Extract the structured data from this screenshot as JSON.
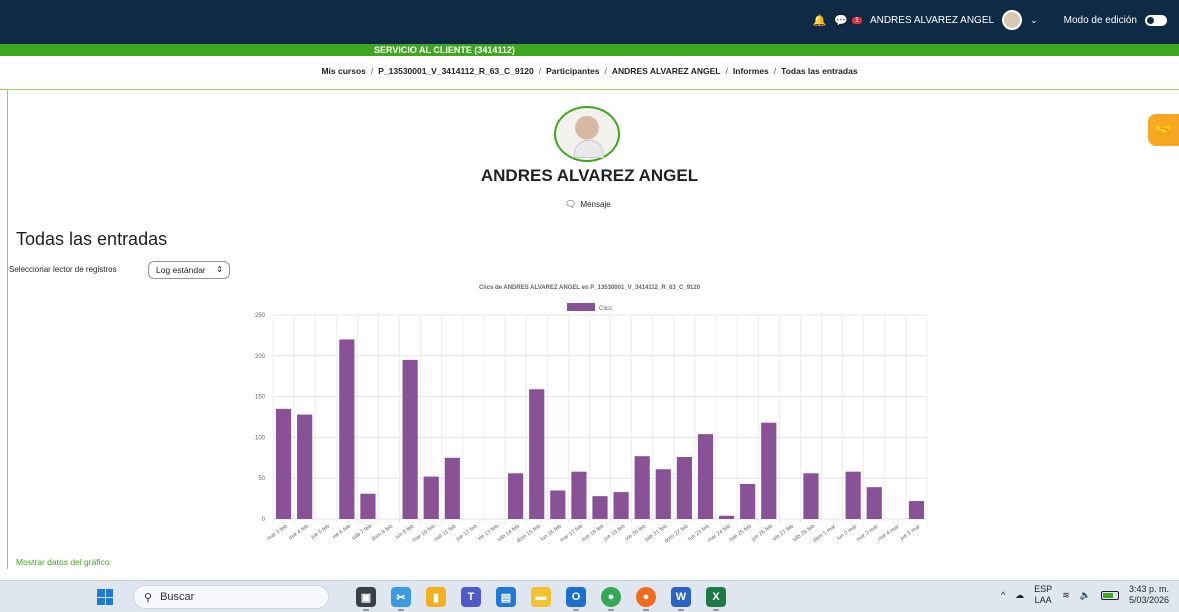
{
  "topbar": {
    "user_name": "ANDRES ALVAREZ ANGEL",
    "edit_mode_label": "Modo de edición",
    "messages_badge": "1"
  },
  "course_banner": "SERVICIO AL CLIENTE (3414112)",
  "breadcrumb": [
    "Mis cursos",
    "P_13530001_V_3414112_R_63_C_9120",
    "Participantes",
    "ANDRES ALVAREZ ANGEL",
    "Informes",
    "Todas las entradas"
  ],
  "profile": {
    "name": "ANDRES ALVAREZ ANGEL",
    "message_label": "Mensaje"
  },
  "page": {
    "heading": "Todas las entradas",
    "selector_label": "Seleccionar lector de registros",
    "selector_value": "Log estándar",
    "show_data_link": "Mostrar datos del gráfico"
  },
  "chart_data": {
    "type": "bar",
    "title": "Clics de ANDRES ALVAREZ ANGEL  en P_13530001_V_3414112_R_63_C_9120",
    "legend_position": "top",
    "bar_color": "#8a5296",
    "ylim": [
      0,
      250
    ],
    "yticks": [
      0,
      50,
      100,
      150,
      200,
      250
    ],
    "grid": true,
    "categories": [
      "mar 3 feb",
      "mié 4 feb",
      "jue 5 feb",
      "vie 6 feb",
      "sáb 7 feb",
      "dom 8 feb",
      "lun 9 feb",
      "mar 10 feb",
      "mié 11 feb",
      "jue 12 feb",
      "vie 13 feb",
      "sáb 14 feb",
      "dom 15 feb",
      "lun 16 feb",
      "mar 17 feb",
      "mié 18 feb",
      "jue 19 feb",
      "vie 20 feb",
      "sáb 21 feb",
      "dom 22 feb",
      "lun 23 feb",
      "mar 24 feb",
      "mié 25 feb",
      "jue 26 feb",
      "vie 27 feb",
      "sáb 28 feb",
      "dom 1 mar",
      "lun 2 mar",
      "mar 3 mar",
      "mié 4 mar",
      "jue 5 mar"
    ],
    "series": [
      {
        "name": "Clics",
        "values": [
          135,
          128,
          0,
          220,
          31,
          0,
          195,
          52,
          75,
          0,
          0,
          56,
          159,
          35,
          58,
          28,
          33,
          77,
          61,
          76,
          104,
          4,
          43,
          118,
          0,
          56,
          0,
          58,
          39,
          0,
          22
        ]
      }
    ]
  },
  "taskbar": {
    "search_label": "Buscar",
    "language_top": "ESP",
    "language_bottom": "LAA",
    "time": "3:43 p. m.",
    "date": "5/03/2026"
  }
}
